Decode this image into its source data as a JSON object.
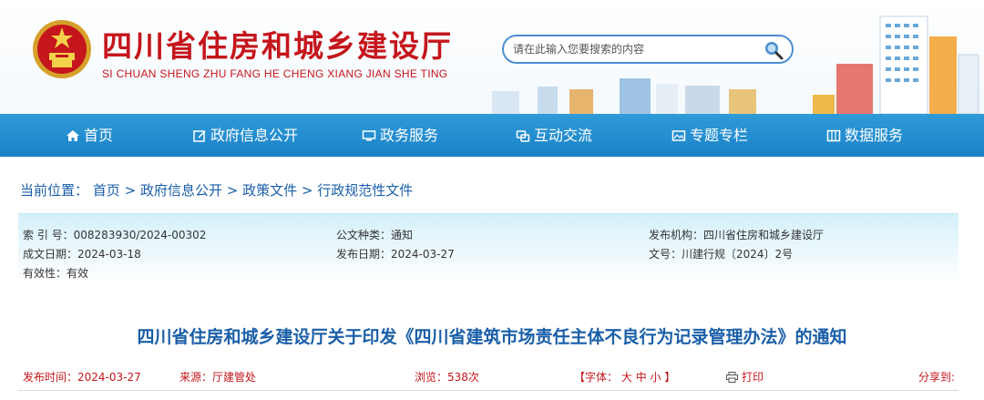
{
  "header": {
    "title": "四川省住房和城乡建设厅",
    "pinyin": "SI CHUAN SHENG ZHU FANG HE CHENG XIANG JIAN SHE TING",
    "emblem_icon": "national-emblem-icon",
    "accent_color": "#c4161c"
  },
  "search": {
    "placeholder": "请在此输入您要搜索的内容",
    "button_icon": "search-icon"
  },
  "nav": {
    "items": [
      {
        "label": "首页",
        "icon": "home-icon"
      },
      {
        "label": "政府信息公开",
        "icon": "edit-icon"
      },
      {
        "label": "政务服务",
        "icon": "monitor-icon"
      },
      {
        "label": "互动交流",
        "icon": "chat-icon"
      },
      {
        "label": "专题专栏",
        "icon": "image-icon"
      },
      {
        "label": "数据服务",
        "icon": "grid-icon"
      }
    ],
    "bg_color": "#1a82c8"
  },
  "breadcrumb": {
    "prefix": "当前位置：",
    "items": [
      "首页",
      "政府信息公开",
      "政策文件",
      "行政规范性文件"
    ],
    "separator": ">"
  },
  "info": {
    "index_no": "索 引 号：008283930/2024-00302",
    "doc_type": "公文种类：通知",
    "publisher": "发布机构：四川省住房和城乡建设厅",
    "created_date": "成文日期：2024-03-18",
    "publish_date": "发布日期：2024-03-27",
    "doc_no": "文号：川建行规〔2024〕2号",
    "validity": "有效性：有效"
  },
  "article": {
    "title": "四川省住房和城乡建设厅关于印发《四川省建筑市场责任主体不良行为记录管理办法》的通知",
    "publish_time": "发布时间：2024-03-27",
    "source": "来源：厅建管处",
    "views": "浏览：538次",
    "font_prefix": "【字体：",
    "font_large": "大",
    "font_medium": "中",
    "font_small": "小",
    "font_suffix": "】",
    "print_label": "打印",
    "share_label": "分享到:"
  }
}
